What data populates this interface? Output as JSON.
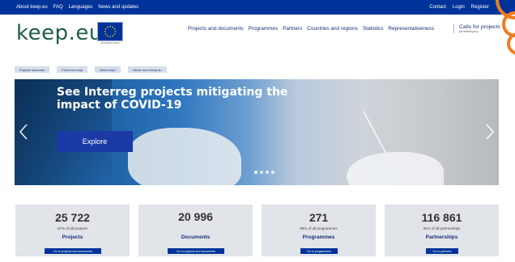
{
  "topbar": {
    "about": "About keep.eu",
    "faq": "FAQ",
    "languages": "Languages",
    "news": "News and updates",
    "contact": "Contact",
    "login": "Login",
    "register": "Register"
  },
  "header": {
    "logo": "keep.eu",
    "eu_caption": "EUROPEAN UNION",
    "nav": [
      "Projects and documents",
      "Programmes",
      "Partners",
      "Countries and regions",
      "Statistics",
      "Representativeness"
    ],
    "calls_title": "Calls for projects",
    "calls_sub": "(at interreg.eu)"
  },
  "chips": [
    "Popular searches",
    "Find from map",
    "Need help?",
    "News from Keep.eu"
  ],
  "hero": {
    "title": "See Interreg projects mitigating the impact of COVID-19",
    "button": "Explore"
  },
  "stats": [
    {
      "number": "25 722",
      "pct": "87% of all projects",
      "label": "Projects",
      "button": "Go to projects and documents"
    },
    {
      "number": "20 996",
      "pct": "",
      "label": "Documents",
      "button": "Go to projects and documents"
    },
    {
      "number": "271",
      "pct": "98% of all programmes",
      "label": "Programmes",
      "button": "Go to programmes"
    },
    {
      "number": "116 861",
      "pct": "82% of all partnerships",
      "label": "Partnerships",
      "button": "Go to partners"
    }
  ],
  "colors": {
    "topbar": "#003399",
    "nav_text": "#1a2d7a",
    "logo": "#1e5d4a",
    "accent_orange": "#f07c1e",
    "button": "#003399",
    "card_bg": "#e1e4e9"
  }
}
